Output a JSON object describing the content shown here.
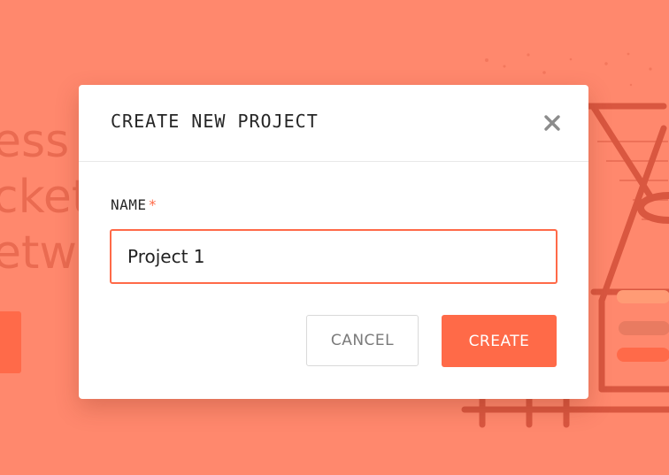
{
  "background": {
    "partial_lines": [
      "ess c",
      "ckett",
      "etw"
    ]
  },
  "dialog": {
    "title": "CREATE NEW PROJECT",
    "field_label": "NAME",
    "required_marker": "*",
    "name_value": "Project 1",
    "cancel_label": "CANCEL",
    "create_label": "CREATE"
  },
  "icons": {
    "close": "close-icon"
  },
  "colors": {
    "page_background": "#ff8a6f",
    "accent": "#ff6a48",
    "dialog_background": "#ffffff",
    "text": "#262626",
    "muted_text": "#7a7a7a",
    "border": "#d9d9d9"
  }
}
